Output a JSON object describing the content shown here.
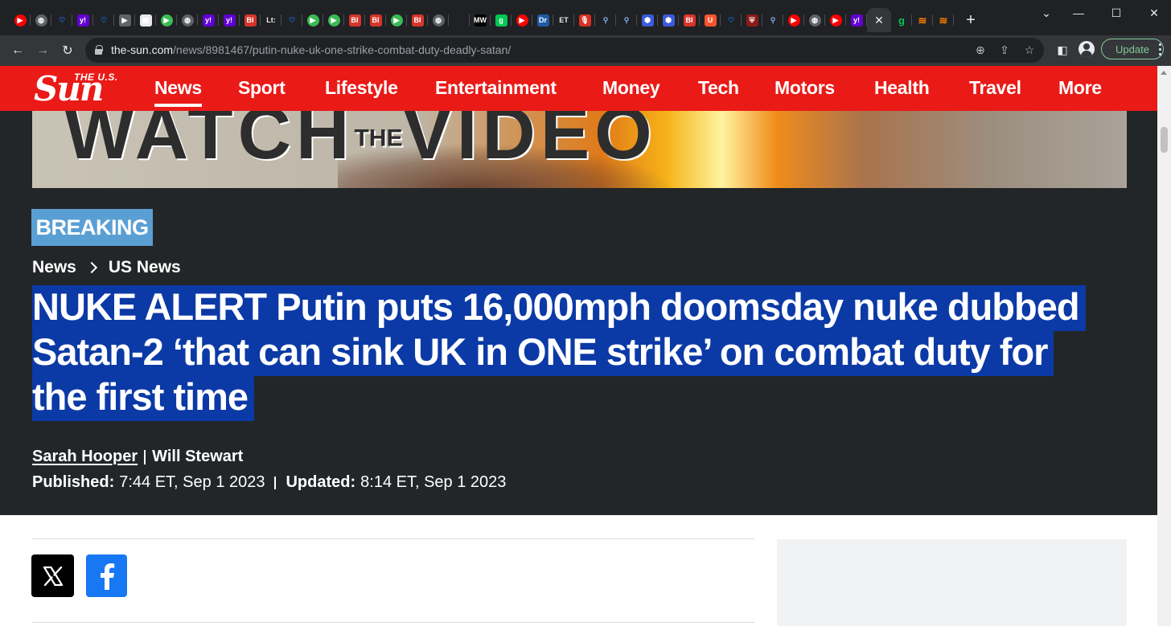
{
  "browser": {
    "tabs": [
      {
        "icon": "youtube-icon",
        "color": "#ff0000",
        "glyph": "▶"
      },
      {
        "icon": "globe-icon",
        "color": "#5f6368",
        "glyph": "◍"
      },
      {
        "icon": "shield-icon",
        "color": "#1a73e8",
        "glyph": "♡"
      },
      {
        "icon": "yahoo-icon",
        "color": "#6001d2",
        "glyph": "y!"
      },
      {
        "icon": "shield-icon",
        "color": "#1a73e8",
        "glyph": "♡"
      },
      {
        "icon": "tag-icon",
        "color": "#5f6368",
        "glyph": "▶"
      },
      {
        "icon": "sheet-icon",
        "color": "#e8eaed",
        "glyph": "▦"
      },
      {
        "icon": "play-circle-icon",
        "color": "#3cba54",
        "glyph": "▶"
      },
      {
        "icon": "globe-icon",
        "color": "#5f6368",
        "glyph": "◍"
      },
      {
        "icon": "yahoo-icon",
        "color": "#6001d2",
        "glyph": "y!"
      },
      {
        "icon": "yahoo-icon",
        "color": "#6001d2",
        "glyph": "y!"
      },
      {
        "icon": "business-insider-icon",
        "color": "#d8352a",
        "glyph": "BI"
      },
      {
        "icon": "lj-icon",
        "color": "#202124",
        "glyph": "Lt:"
      },
      {
        "icon": "shield-icon",
        "color": "#1a73e8",
        "glyph": "♡"
      },
      {
        "icon": "play-circle-icon",
        "color": "#3cba54",
        "glyph": "▶"
      },
      {
        "icon": "play-circle-icon",
        "color": "#3cba54",
        "glyph": "▶"
      },
      {
        "icon": "business-insider-icon",
        "color": "#d8352a",
        "glyph": "BI"
      },
      {
        "icon": "business-insider-icon",
        "color": "#d8352a",
        "glyph": "BI"
      },
      {
        "icon": "play-circle-icon",
        "color": "#3cba54",
        "glyph": "▶"
      },
      {
        "icon": "business-insider-icon",
        "color": "#d8352a",
        "glyph": "BI"
      },
      {
        "icon": "globe-icon",
        "color": "#5f6368",
        "glyph": "◍"
      },
      {
        "icon": "sunburst-icon",
        "color": "#202124",
        "glyph": "✺"
      },
      {
        "icon": "mw-icon",
        "color": "#000000",
        "glyph": "MW"
      },
      {
        "icon": "g-icon",
        "color": "#00c853",
        "glyph": "g"
      },
      {
        "icon": "youtube-icon",
        "color": "#ff0000",
        "glyph": "▶"
      },
      {
        "icon": "drudge-icon",
        "color": "#1f5aa6",
        "glyph": "Dr"
      },
      {
        "icon": "et-icon",
        "color": "#202124",
        "glyph": "ET"
      },
      {
        "icon": "mic-icon",
        "color": "#d93025",
        "glyph": "🎙"
      },
      {
        "icon": "search-icon",
        "color": "#8ab4f8",
        "glyph": "⚲"
      },
      {
        "icon": "search-icon",
        "color": "#8ab4f8",
        "glyph": "⚲"
      },
      {
        "icon": "hex-icon",
        "color": "#3b5bdb",
        "glyph": "⬢"
      },
      {
        "icon": "hex-icon",
        "color": "#3b5bdb",
        "glyph": "⬢"
      },
      {
        "icon": "business-insider-icon",
        "color": "#d8352a",
        "glyph": "BI"
      },
      {
        "icon": "brave-icon",
        "color": "#fb542b",
        "glyph": "U"
      },
      {
        "icon": "shield-icon",
        "color": "#1a73e8",
        "glyph": "♡"
      },
      {
        "icon": "crest-icon",
        "color": "#8b1a1a",
        "glyph": "⛨"
      },
      {
        "icon": "search-icon",
        "color": "#8ab4f8",
        "glyph": "⚲"
      },
      {
        "icon": "youtube-icon",
        "color": "#ff0000",
        "glyph": "▶"
      },
      {
        "icon": "globe-icon",
        "color": "#5f6368",
        "glyph": "◍"
      },
      {
        "icon": "youtube-icon",
        "color": "#ff0000",
        "glyph": "▶"
      },
      {
        "icon": "yahoo-icon",
        "color": "#6001d2",
        "glyph": "y!"
      }
    ],
    "after_tabs": [
      {
        "icon": "g-icon",
        "color": "#00c853",
        "glyph": "g"
      },
      {
        "icon": "bookmark-stack-icon",
        "color": "#f57c00",
        "glyph": "≋"
      },
      {
        "icon": "bookmark-stack-icon",
        "color": "#f57c00",
        "glyph": "≋"
      }
    ],
    "active_tab_close": "✕",
    "new_tab": "+",
    "url_host": "the-sun.com",
    "url_path": "/news/8981467/putin-nuke-uk-one-strike-combat-duty-deadly-satan/",
    "update_label": "Update"
  },
  "site": {
    "logo_top": "THE U.S.",
    "logo_main": "Sun",
    "nav": [
      "News",
      "Sport",
      "Lifestyle",
      "Entertainment",
      "Money",
      "Tech",
      "Motors",
      "Health",
      "Travel",
      "More"
    ],
    "active_nav": "News"
  },
  "hero": {
    "text_left": "WATCH",
    "text_mid": "THE",
    "text_right": "VIDEO"
  },
  "article": {
    "badge": "BREAKING",
    "breadcrumb": [
      "News",
      "US News"
    ],
    "headline": "NUKE ALERT Putin puts 16,000mph doomsday nuke dubbed Satan-2 ‘that can sink UK in ONE strike’ on combat duty for the first time",
    "authors": [
      "Sarah Hooper",
      "Will Stewart"
    ],
    "published_label": "Published:",
    "published_value": "7:44 ET, Sep 1 2023",
    "updated_label": "Updated:",
    "updated_value": "8:14 ET, Sep 1 2023"
  },
  "colors": {
    "brand_red": "#ea1a17",
    "badge_blue": "#5a9fd4",
    "selection_blue": "#0b3aa6",
    "facebook_blue": "#1877f2"
  }
}
